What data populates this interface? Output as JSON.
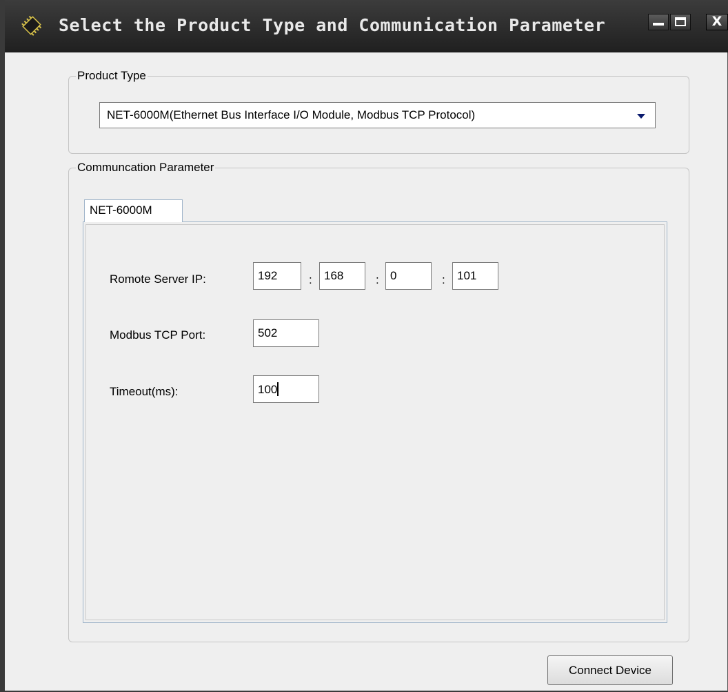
{
  "window": {
    "title": "Select the Product Type and Communication Parameter",
    "app_icon": "chip-icon",
    "controls": {
      "minimize_icon": "minimize-icon",
      "maximize_icon": "maximize-icon",
      "close_label": "X"
    }
  },
  "product_type": {
    "group_label": "Product Type",
    "selected": "NET-6000M(Ethernet Bus Interface I/O Module, Modbus TCP Protocol)",
    "dropdown_icon": "chevron-down-icon"
  },
  "communication": {
    "group_label": "Communcation Parameter",
    "tabs": [
      {
        "label": "NET-6000M",
        "active": true
      }
    ],
    "remote_ip": {
      "label": "Romote Server IP:",
      "octets": [
        "192",
        "168",
        "0",
        "101"
      ],
      "separator": ":"
    },
    "port": {
      "label": "Modbus TCP Port:",
      "value": "502"
    },
    "timeout": {
      "label": "Timeout(ms):",
      "value": "100"
    }
  },
  "actions": {
    "connect_label": "Connect Device"
  },
  "colors": {
    "titlebar": "#2a2a2a",
    "title_text": "#e9e9e9",
    "window_bg": "#efefef",
    "dropdown_arrow": "#0a1a6e",
    "tab_border": "#9fb4c9"
  }
}
